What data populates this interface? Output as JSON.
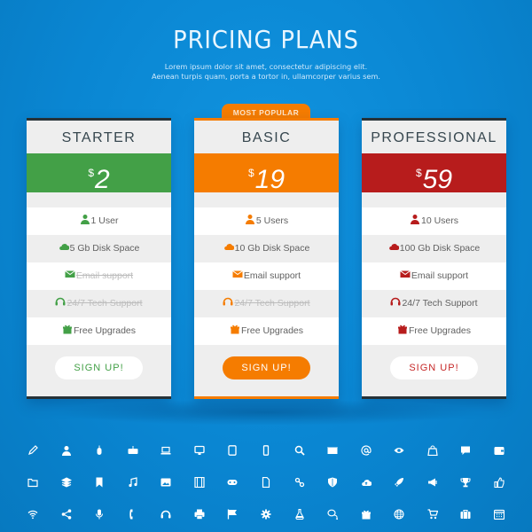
{
  "header": {
    "title": "PRICING PLANS",
    "subtitle_line1": "Lorem ipsum dolor sit amet, consectetur  adipiscing elit.",
    "subtitle_line2": "Aenean turpis quam, porta  a tortor in, ullamcorper varius sem."
  },
  "badge": {
    "label": "MOST POPULAR"
  },
  "plans": [
    {
      "name": "STARTER",
      "currency": "$",
      "price": "2",
      "color": "#43a047",
      "features": [
        {
          "icon": "user-icon",
          "text": "1 User",
          "included": true
        },
        {
          "icon": "cloud-icon",
          "text": "5 Gb Disk Space",
          "included": true
        },
        {
          "icon": "mail-icon",
          "text": "Email support",
          "included": false
        },
        {
          "icon": "headset-icon",
          "text": "24/7 Tech Support",
          "included": false
        },
        {
          "icon": "gift-icon",
          "text": "Free Upgrades",
          "included": true
        }
      ],
      "cta": "SIGN UP!"
    },
    {
      "name": "BASIC",
      "currency": "$",
      "price": "19",
      "color": "#f57c00",
      "features": [
        {
          "icon": "user-icon",
          "text": "5 Users",
          "included": true
        },
        {
          "icon": "cloud-icon",
          "text": "10 Gb Disk Space",
          "included": true
        },
        {
          "icon": "mail-icon",
          "text": "Email support",
          "included": true
        },
        {
          "icon": "headset-icon",
          "text": "24/7 Tech Support",
          "included": false
        },
        {
          "icon": "gift-icon",
          "text": "Free Upgrades",
          "included": true
        }
      ],
      "cta": "SIGN UP!"
    },
    {
      "name": "PROFESSIONAL",
      "currency": "$",
      "price": "59",
      "color": "#b71c1c",
      "features": [
        {
          "icon": "user-icon",
          "text": "10 Users",
          "included": true
        },
        {
          "icon": "cloud-icon",
          "text": "100 Gb Disk Space",
          "included": true
        },
        {
          "icon": "mail-icon",
          "text": "Email support",
          "included": true
        },
        {
          "icon": "headset-icon",
          "text": "24/7 Tech Support",
          "included": true
        },
        {
          "icon": "gift-icon",
          "text": "Free Upgrades",
          "included": true
        }
      ],
      "cta": "SIGN UP!"
    }
  ],
  "icon_grid": [
    [
      "pencil-icon",
      "user-icon",
      "mouse-icon",
      "keyboard-icon",
      "laptop-icon",
      "monitor-icon",
      "tablet-icon",
      "phone-icon",
      "search-icon",
      "mail-icon",
      "at-icon",
      "eye-icon",
      "shopping-bag-icon",
      "chat-icon",
      "wallet-icon"
    ],
    [
      "folder-icon",
      "layers-icon",
      "bookmark-icon",
      "music-icon",
      "image-icon",
      "film-icon",
      "gamepad-icon",
      "document-icon",
      "link-icon",
      "shield-icon",
      "cloud-upload-icon",
      "rocket-icon",
      "megaphone-icon",
      "trophy-icon",
      "thumbs-up-icon"
    ],
    [
      "wifi-icon",
      "share-icon",
      "microphone-icon",
      "telephone-icon",
      "headset-icon",
      "printer-icon",
      "flag-icon",
      "gear-icon",
      "flask-icon",
      "chat-bubbles-icon",
      "gift-icon",
      "globe-icon",
      "cart-icon",
      "briefcase-icon",
      "calendar-icon"
    ]
  ],
  "colors": {
    "background": "#0a86d2",
    "starter": "#43a047",
    "basic": "#f57c00",
    "professional": "#b71c1c",
    "card_dark_border": "#263238"
  }
}
